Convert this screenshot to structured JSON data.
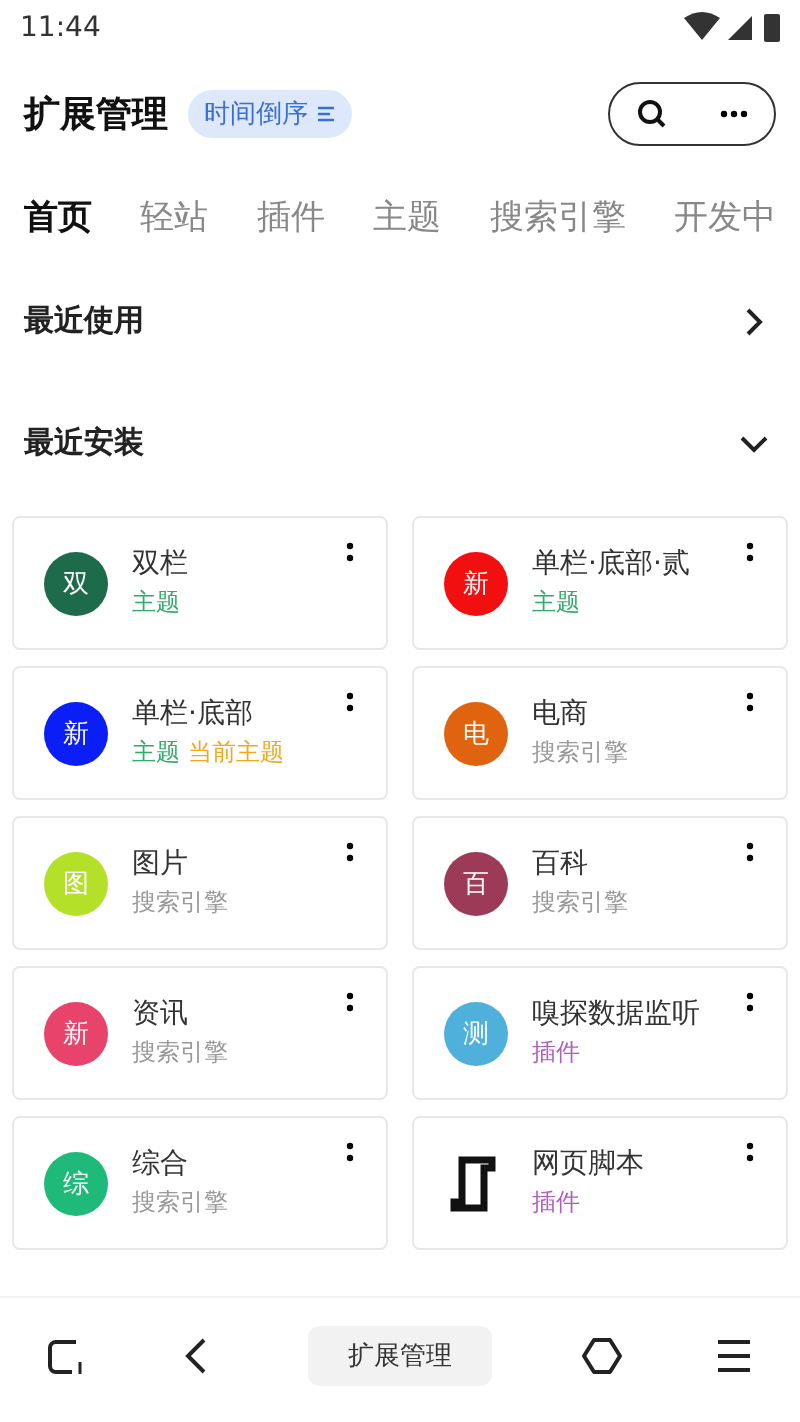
{
  "status_bar": {
    "time": "11:44"
  },
  "header": {
    "title": "扩展管理",
    "sort_chip": "时间倒序"
  },
  "tabs": [
    {
      "label": "首页",
      "selected": true
    },
    {
      "label": "轻站",
      "selected": false
    },
    {
      "label": "插件",
      "selected": false
    },
    {
      "label": "主题",
      "selected": false
    },
    {
      "label": "搜索引擎",
      "selected": false
    },
    {
      "label": "开发中",
      "selected": false
    }
  ],
  "sections": [
    {
      "title": "最近使用",
      "expanded": false
    },
    {
      "title": "最近安装",
      "expanded": true
    }
  ],
  "cards": [
    {
      "kind": "letter",
      "glyph": "双",
      "color": "#1e6b4c",
      "name": "双栏",
      "tags": [
        {
          "kind": "theme",
          "text": "主题"
        }
      ]
    },
    {
      "kind": "letter",
      "glyph": "新",
      "color": "#f20f0f",
      "name": "单栏·底部·贰",
      "tags": [
        {
          "kind": "theme",
          "text": "主题"
        }
      ]
    },
    {
      "kind": "letter",
      "glyph": "新",
      "color": "#0a1ef5",
      "name": "单栏·底部",
      "tags": [
        {
          "kind": "theme",
          "text": "主题"
        },
        {
          "kind": "current",
          "text": "当前主题"
        }
      ]
    },
    {
      "kind": "letter",
      "glyph": "电",
      "color": "#e0640f",
      "name": "电商",
      "tags": [
        {
          "kind": "search",
          "text": "搜索引擎"
        }
      ]
    },
    {
      "kind": "letter",
      "glyph": "图",
      "color": "#b5e02a",
      "name": "图片",
      "tags": [
        {
          "kind": "search",
          "text": "搜索引擎"
        }
      ]
    },
    {
      "kind": "letter",
      "glyph": "百",
      "color": "#9c3a58",
      "name": "百科",
      "tags": [
        {
          "kind": "search",
          "text": "搜索引擎"
        }
      ]
    },
    {
      "kind": "letter",
      "glyph": "新",
      "color": "#e8436a",
      "name": "资讯",
      "tags": [
        {
          "kind": "search",
          "text": "搜索引擎"
        }
      ]
    },
    {
      "kind": "letter",
      "glyph": "测",
      "color": "#4fb0dc",
      "name": "嗅探数据监听",
      "tags": [
        {
          "kind": "plugin",
          "text": "插件"
        }
      ]
    },
    {
      "kind": "letter",
      "glyph": "综",
      "color": "#1fba7a",
      "name": "综合",
      "tags": [
        {
          "kind": "search",
          "text": "搜索引擎"
        }
      ]
    },
    {
      "kind": "script",
      "name": "网页脚本",
      "tags": [
        {
          "kind": "plugin",
          "text": "插件"
        }
      ]
    }
  ],
  "bottom_nav": {
    "label": "扩展管理"
  }
}
